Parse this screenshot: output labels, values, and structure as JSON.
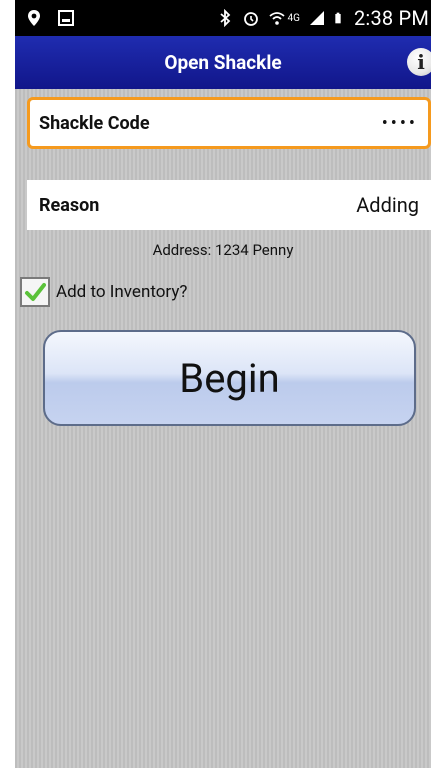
{
  "status_bar": {
    "time": "2:38 PM",
    "network": "4G",
    "icons": [
      "location-icon",
      "image-icon",
      "bluetooth-icon",
      "alarm-icon",
      "wifi-icon",
      "signal-icon",
      "battery-icon"
    ]
  },
  "header": {
    "title": "Open Shackle",
    "info_icon": "info-icon"
  },
  "form": {
    "shackle_code": {
      "label": "Shackle Code",
      "value": "••••"
    },
    "reason": {
      "label": "Reason",
      "value": "Adding"
    },
    "address": "Address: 1234 Penny",
    "add_to_inventory": {
      "label": "Add to Inventory?",
      "checked": true
    }
  },
  "begin_button": {
    "label": "Begin"
  },
  "colors": {
    "header": "#1b25a5",
    "focus_border": "#f59a1e",
    "check": "#5bc23a"
  }
}
